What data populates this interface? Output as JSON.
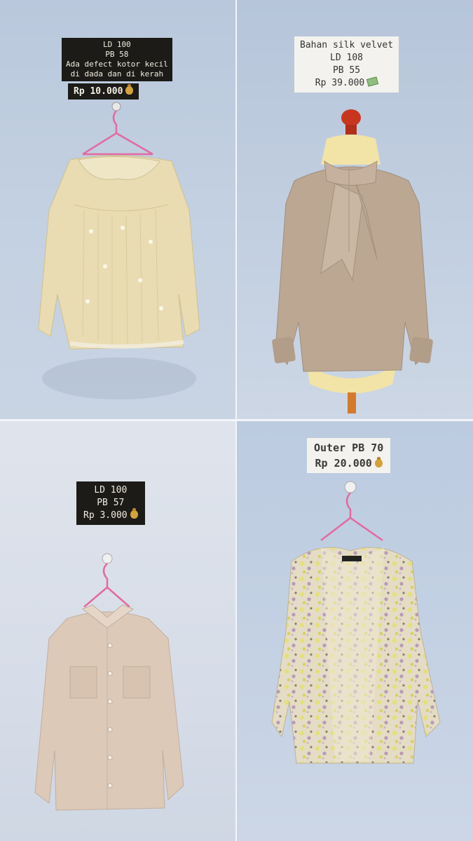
{
  "panels": [
    {
      "tag_lines": [
        "LD 100",
        "PB 58",
        "Ada defect kotor kecil",
        "di dada dan di kerah"
      ],
      "price": "Rp 10.000",
      "price_icon": "money-bag-icon",
      "garment_color": "#e9dcb2"
    },
    {
      "tag_lines": [
        "Bahan silk velvet",
        "LD 108",
        "PB 55",
        "Rp 39.000"
      ],
      "price_icon": "money-with-wings-icon",
      "garment_color": "#bca793"
    },
    {
      "tag_lines": [
        "LD 100",
        "PB 57",
        "Rp 3.000"
      ],
      "price_icon": "money-bag-icon",
      "garment_color": "#ddc9b8"
    },
    {
      "tag_lines": [
        "Outer PB 70",
        "Rp 20.000"
      ],
      "price_icon": "money-bag-icon",
      "garment_color": "#e6df9a"
    }
  ]
}
